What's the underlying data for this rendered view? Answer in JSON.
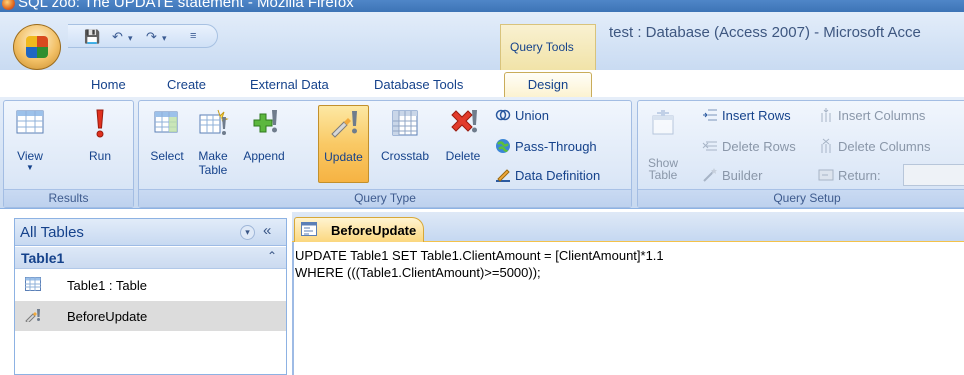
{
  "browser_title": "SQL zoo: The UPDATE statement - Mozilla Firefox",
  "app_title": "test : Database (Access 2007) - Microsoft Acce",
  "context_tab_group": "Query Tools",
  "tabs": [
    {
      "label": "Home"
    },
    {
      "label": "Create"
    },
    {
      "label": "External Data"
    },
    {
      "label": "Database Tools"
    }
  ],
  "active_tab": "Design",
  "groups": {
    "results": {
      "label": "Results",
      "view": "View",
      "run": "Run"
    },
    "query_type": {
      "label": "Query Type",
      "select": "Select",
      "make_table": "Make Table",
      "append": "Append",
      "update": "Update",
      "crosstab": "Crosstab",
      "delete": "Delete",
      "union": "Union",
      "pass_through": "Pass-Through",
      "data_definition": "Data Definition"
    },
    "query_setup": {
      "label": "Query Setup",
      "show_table": "Show Table",
      "insert_rows": "Insert Rows",
      "delete_rows": "Delete Rows",
      "builder": "Builder",
      "insert_columns": "Insert Columns",
      "delete_columns": "Delete Columns",
      "return": "Return:"
    }
  },
  "nav": {
    "title": "All Tables",
    "group": "Table1",
    "items": [
      {
        "label": "Table1 : Table"
      },
      {
        "label": "BeforeUpdate"
      }
    ]
  },
  "document": {
    "tab": "BeforeUpdate",
    "sql_line1": "UPDATE Table1 SET Table1.ClientAmount = [ClientAmount]*1.1",
    "sql_line2": "WHERE (((Table1.ClientAmount)>=5000));"
  }
}
